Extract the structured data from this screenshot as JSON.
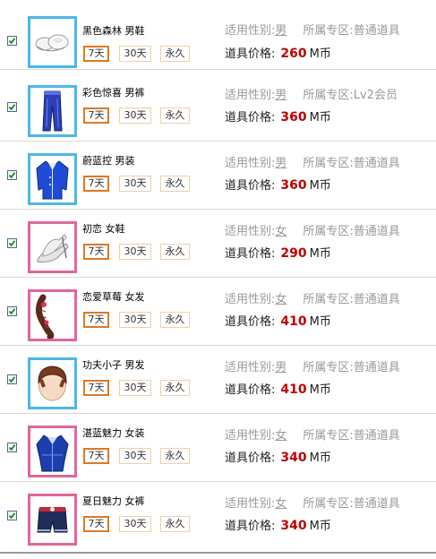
{
  "labels": {
    "gender_label": "适用性别:",
    "zone_label": "所属专区:",
    "price_label": "道具价格:",
    "currency": "M币"
  },
  "colors": {
    "male_frame": "#4bb8e6",
    "female_frame": "#e0679c",
    "price": "#c00000",
    "selected_duration_border": "#e07820"
  },
  "items": [
    {
      "name": "黑色森林 男鞋",
      "gender": "男",
      "zone": "普通道具",
      "price": "260",
      "frame": "male",
      "icon": "white-shoes-icon",
      "checked": true,
      "durations": [
        "7天",
        "30天",
        "永久"
      ],
      "selected": 0
    },
    {
      "name": "彩色惊喜 男裤",
      "gender": "男",
      "zone": "Lv2会员",
      "price": "360",
      "frame": "male",
      "icon": "blue-pants-icon",
      "checked": true,
      "durations": [
        "7天",
        "30天",
        "永久"
      ],
      "selected": 0
    },
    {
      "name": "蔚蓝控 男装",
      "gender": "男",
      "zone": "普通道具",
      "price": "360",
      "frame": "male",
      "icon": "blue-jacket-icon",
      "checked": true,
      "durations": [
        "7天",
        "30天",
        "永久"
      ],
      "selected": 0
    },
    {
      "name": "初恋 女鞋",
      "gender": "女",
      "zone": "普通道具",
      "price": "290",
      "frame": "female",
      "icon": "silver-heels-icon",
      "checked": true,
      "durations": [
        "7天",
        "30天",
        "永久"
      ],
      "selected": 0
    },
    {
      "name": "恋爱草莓 女发",
      "gender": "女",
      "zone": "普通道具",
      "price": "410",
      "frame": "female",
      "icon": "braided-hair-icon",
      "checked": true,
      "durations": [
        "7天",
        "30天",
        "永久"
      ],
      "selected": 0
    },
    {
      "name": "功夫小子 男发",
      "gender": "男",
      "zone": "普通道具",
      "price": "410",
      "frame": "male",
      "icon": "brown-hair-icon",
      "checked": true,
      "durations": [
        "7天",
        "30天",
        "永久"
      ],
      "selected": 0
    },
    {
      "name": "湛蓝魅力 女装",
      "gender": "女",
      "zone": "普通道具",
      "price": "340",
      "frame": "female",
      "icon": "blue-outfit-icon",
      "checked": true,
      "durations": [
        "7天",
        "30天",
        "永久"
      ],
      "selected": 0
    },
    {
      "name": "夏日魅力 女裤",
      "gender": "女",
      "zone": "普通道具",
      "price": "340",
      "frame": "female",
      "icon": "denim-shorts-icon",
      "checked": true,
      "durations": [
        "7天",
        "30天",
        "永久"
      ],
      "selected": 0
    }
  ]
}
